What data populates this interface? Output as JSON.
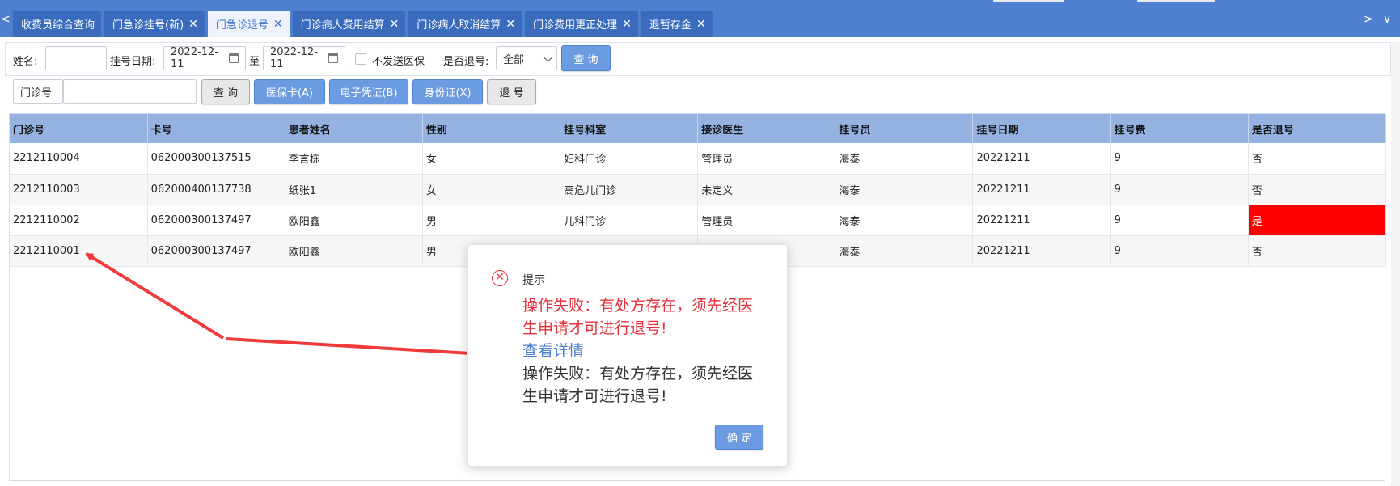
{
  "tabbar": {
    "bg_color": "#4f7fcf",
    "tabs": [
      {
        "label": "收费员综合查询",
        "closable": false,
        "active": false
      },
      {
        "label": "门急诊挂号(新)",
        "closable": true,
        "active": false
      },
      {
        "label": "门急诊退号",
        "closable": true,
        "active": true
      },
      {
        "label": "门诊病人费用结算",
        "closable": true,
        "active": false
      },
      {
        "label": "门诊病人取消结算",
        "closable": true,
        "active": false
      },
      {
        "label": "门诊费用更正处理",
        "closable": true,
        "active": false
      },
      {
        "label": "退暂存金",
        "closable": true,
        "active": false
      }
    ],
    "scroll_left": "<",
    "scroll_right": ">",
    "menu_icon": "∨",
    "close_symbol": "✕"
  },
  "filters": {
    "name_label": "姓名:",
    "name_value": "",
    "date_label": "挂号日期:",
    "date_from": "2022-12-11",
    "date_to_label": "至",
    "date_to": "2022-12-11",
    "no_insurance_label": "不发送医保",
    "is_refunded_label": "是否退号:",
    "is_refunded_value": "全部",
    "query_label": "查 询"
  },
  "lookup": {
    "clinic_no_label": "门诊号",
    "clinic_no_value": "",
    "query_label": "查 询",
    "insurance_card_label": "医保卡(A)",
    "e_voucher_label": "电子凭证(B)",
    "id_card_label": "身份证(X)",
    "refund_label": "退 号"
  },
  "table": {
    "headers": [
      "门诊号",
      "卡号",
      "患者姓名",
      "性别",
      "挂号科室",
      "接诊医生",
      "挂号员",
      "挂号日期",
      "挂号费",
      "是否退号"
    ],
    "rows": [
      [
        "2212110004",
        "062000300137515",
        "李言栋",
        "女",
        "妇科门诊",
        "管理员",
        "海泰",
        "20221211",
        "9",
        "否"
      ],
      [
        "2212110003",
        "062000400137738",
        "纸张1",
        "女",
        "高危儿门诊",
        "未定义",
        "海泰",
        "20221211",
        "9",
        "否"
      ],
      [
        "2212110002",
        "062000300137497",
        "欧阳鑫",
        "男",
        "儿科门诊",
        "管理员",
        "海泰",
        "20221211",
        "9",
        "是"
      ],
      [
        "2212110001",
        "062000300137497",
        "欧阳鑫",
        "男",
        "",
        "",
        "海泰",
        "20221211",
        "9",
        "否"
      ]
    ],
    "header_color": "#95b3e0",
    "refunded_color": "#ff0000"
  },
  "dialog": {
    "icon": "error-icon",
    "title": "提示",
    "message_red": "操作失败：有处方存在，须先经医生申请才可进行退号!",
    "details_link": "查看详情",
    "message_detail": "操作失败：有处方存在，须先经医生申请才可进行退号!",
    "ok_label": "确 定",
    "error_color": "#e8313b"
  },
  "annotation": {
    "arrow_color": "#ef3b3b"
  }
}
